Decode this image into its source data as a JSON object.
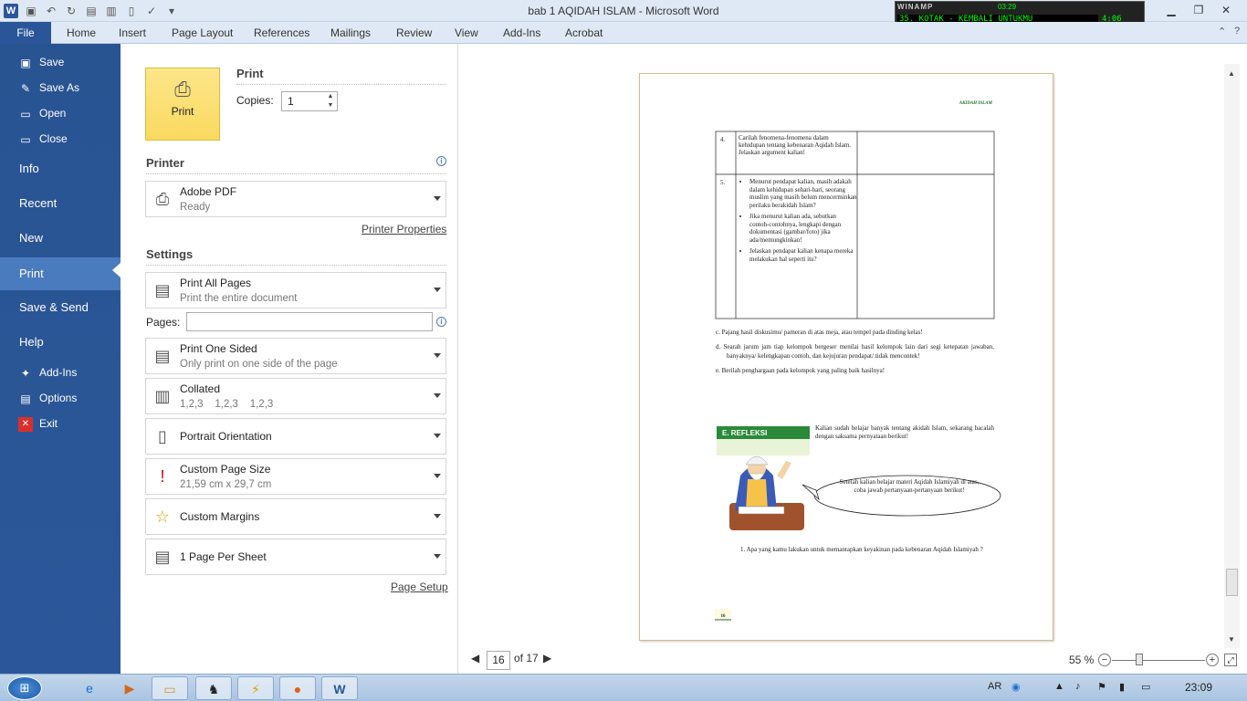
{
  "window": {
    "title": "bab 1 AQIDAH ISLAM  -  Microsoft Word",
    "logo": "W"
  },
  "winamp": {
    "brand": "WINAMP",
    "time_small": "03:29",
    "track": "35. KOTAK - KEMBALI UNTUKMU",
    "time": "4:06"
  },
  "ribbon": {
    "tabs": [
      "File",
      "Home",
      "Insert",
      "Page Layout",
      "References",
      "Mailings",
      "Review",
      "View",
      "Add-Ins",
      "Acrobat"
    ]
  },
  "backstage": {
    "save": "Save",
    "save_as": "Save As",
    "open": "Open",
    "close": "Close",
    "info": "Info",
    "recent": "Recent",
    "new": "New",
    "print": "Print",
    "save_send": "Save & Send",
    "help": "Help",
    "add_ins": "Add-Ins",
    "options": "Options",
    "exit": "Exit"
  },
  "print_panel": {
    "heading": "Print",
    "button_label": "Print",
    "copies_label": "Copies:",
    "copies_value": "1",
    "printer_heading": "Printer",
    "printer_name": "Adobe PDF",
    "printer_status": "Ready",
    "printer_properties": "Printer Properties",
    "settings_heading": "Settings",
    "pages_label": "Pages:",
    "pages_value": "",
    "page_setup": "Page Setup",
    "settings": [
      {
        "title": "Print All Pages",
        "sub": "Print the entire document"
      },
      {
        "title": "Print One Sided",
        "sub": "Only print on one side of the page"
      },
      {
        "title": "Collated",
        "sub": "1,2,3    1,2,3    1,2,3"
      },
      {
        "title": "Portrait Orientation",
        "sub": ""
      },
      {
        "title": "Custom Page Size",
        "sub": "21,59 cm x 29,7 cm"
      },
      {
        "title": "Custom Margins",
        "sub": ""
      },
      {
        "title": "1 Page Per Sheet",
        "sub": ""
      }
    ]
  },
  "preview": {
    "header": "AKIDAH ISLAM",
    "q4_num": "4.",
    "q4": "Carilah fenomena-fenomena dalam kehidupan tentang kebenaran Aqidah Islam. Jelaskan argument kalian!",
    "q5_num": "5.",
    "q5_a": "Menurut pendapat kalian, masih adakah dalam kehidupan sehari-hari, seorang muslim yang masih belum mencerminkan perilaku berakidah Islam?",
    "q5_b": "Jika menurut kalian ada, sebutkan contoh-contohnya, lengkapi dengan dokumentasi (gambar/foto) jika ada/memungkinkan!",
    "q5_c": "Jelaskan pendapat kalian kenapa mereka melakukan hal seperti itu?",
    "step_c": "c.  Pajang hasil diskusimu/ pameran di atas meja, atau tempel pada dinding kelas!",
    "step_d": "d.  Searah jarum jam tiap kelompok bergeser menilai hasil kelompok lain dari segi ketepatan jawaban, banyaknya/ kelengkapan contoh, dan kejujuran pendapat/ tidak mencontek!",
    "step_e": "e.  Berilah penghargaan pada kelompok yang paling baik hasilnya!",
    "refleksi": "E. REFLEKSI",
    "refleksi_text": "Kalian sudah belajar banyak tentang akidah Islam, sekarang bacalah dengan saksama pernyataan berikut!",
    "bubble": "Setelah kalian belajar materi Aqidah Islamiyah di atas, coba jawab pertanyaan-pertanyaan berikut!",
    "question1": "1.  Apa yang kamu lakukan untuk memantapkan keyakinan pada kebenaran Aqidah Islamiyah ?",
    "page_footer": "16"
  },
  "nav": {
    "current": "16",
    "of": "of 17",
    "zoom": "55 %"
  },
  "taskbar": {
    "lang": "AR",
    "clock": "23:09"
  }
}
